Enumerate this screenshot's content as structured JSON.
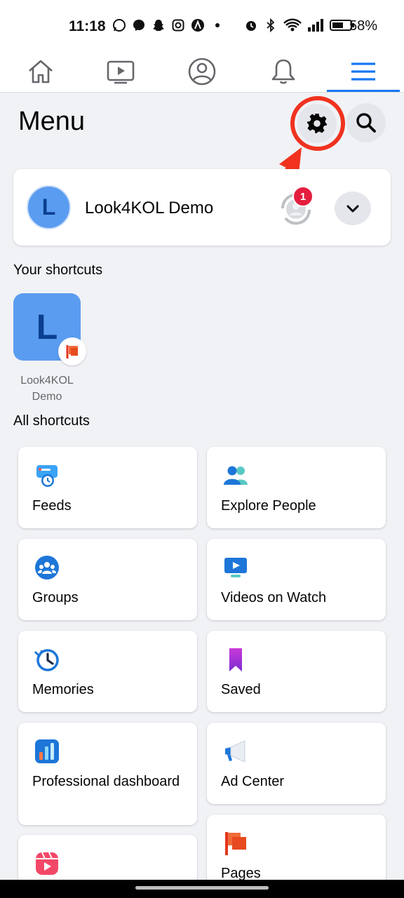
{
  "status_bar": {
    "time": "11:18",
    "battery": "58%",
    "left_icons": [
      "whatsapp-icon",
      "messenger-icon",
      "snapchat-icon",
      "instagram-icon",
      "app-icon",
      "dot-icon"
    ],
    "right_icons": [
      "alarm-icon",
      "bluetooth-icon",
      "wifi-icon",
      "signal-icon",
      "battery-icon"
    ]
  },
  "nav": {
    "items": [
      "home-icon",
      "watch-icon",
      "profile-icon",
      "notifications-icon",
      "menu-icon"
    ],
    "active": "menu-icon",
    "accent": "#1877f2"
  },
  "header": {
    "title": "Menu"
  },
  "profile": {
    "avatar_letter": "L",
    "name": "Look4KOL Demo",
    "switch_badge": "1"
  },
  "your_shortcuts": {
    "heading": "Your shortcuts",
    "items": [
      {
        "letter": "L",
        "label": "Look4KOL Demo"
      }
    ]
  },
  "all_shortcuts": {
    "heading": "All shortcuts",
    "left": [
      {
        "label": "Feeds",
        "icon": "feeds-icon"
      },
      {
        "label": "Groups",
        "icon": "groups-icon"
      },
      {
        "label": "Memories",
        "icon": "memories-icon"
      },
      {
        "label": "Professional dashboard",
        "icon": "dashboard-icon"
      },
      {
        "label": "",
        "icon": "reels-icon"
      }
    ],
    "right": [
      {
        "label": "Explore People",
        "icon": "explore-people-icon"
      },
      {
        "label": "Videos on Watch",
        "icon": "videos-icon"
      },
      {
        "label": "Saved",
        "icon": "saved-icon"
      },
      {
        "label": "Ad Center",
        "icon": "ad-center-icon"
      },
      {
        "label": "Pages",
        "icon": "pages-icon"
      }
    ]
  },
  "colors": {
    "highlight": "#f0321f",
    "badge": "#e41e3f",
    "avatar": "#5a9cf0"
  }
}
